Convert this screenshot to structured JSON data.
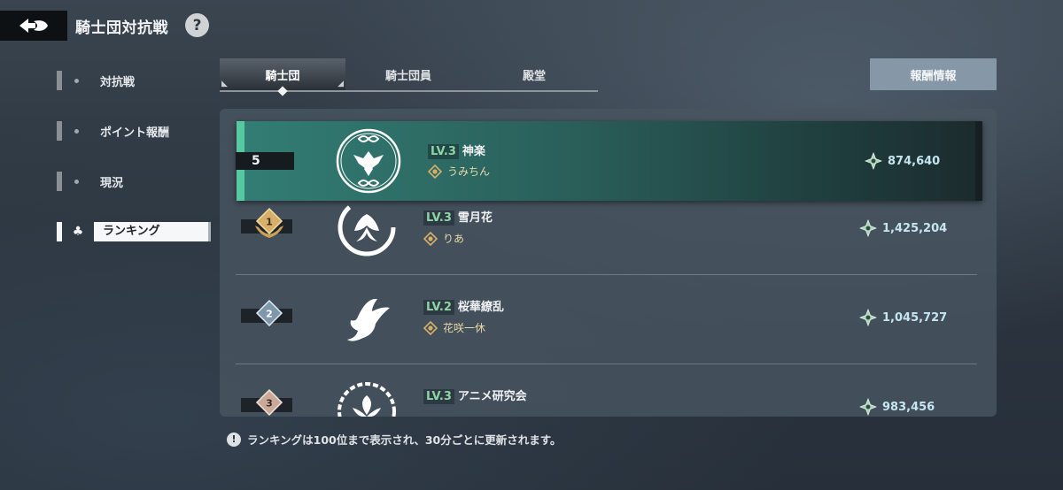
{
  "header": {
    "title": "騎士団対抗戦",
    "help_label": "?"
  },
  "sidebar": {
    "items": [
      {
        "label": "対抗戦",
        "active": false
      },
      {
        "label": "ポイント報酬",
        "active": false
      },
      {
        "label": "現況",
        "active": false
      },
      {
        "label": "ランキング",
        "active": true
      }
    ]
  },
  "tabs": [
    {
      "label": "騎士団",
      "active": true
    },
    {
      "label": "騎士団員",
      "active": false
    },
    {
      "label": "殿堂",
      "active": false
    }
  ],
  "reward_button": "報酬情報",
  "my_guild": {
    "rank": "5",
    "level": "LV.3",
    "name": "神楽",
    "leader": "うみちん",
    "score": "874,640"
  },
  "rankings": [
    {
      "rank": "1",
      "level": "LV.3",
      "name": "雪月花",
      "leader": "りあ",
      "score": "1,425,204"
    },
    {
      "rank": "2",
      "level": "LV.2",
      "name": "桜華繚乱",
      "leader": "花咲一休",
      "score": "1,045,727"
    },
    {
      "rank": "3",
      "level": "LV.3",
      "name": "アニメ研究会",
      "leader": "",
      "score": "983,456"
    }
  ],
  "footer_note": "ランキングは100位まで表示され、30分ごとに更新されます。",
  "colors": {
    "accent_green": "#56c9a1",
    "level_text": "#8fd5a4",
    "gold": "#d6b06a",
    "button_blue": "#8697a8"
  },
  "icons": {
    "back": "back-arrow-icon",
    "help": "question-icon",
    "side_active": "clover-icon",
    "leader": "leader-crest-icon",
    "score": "star-points-icon",
    "note": "exclamation-icon"
  }
}
